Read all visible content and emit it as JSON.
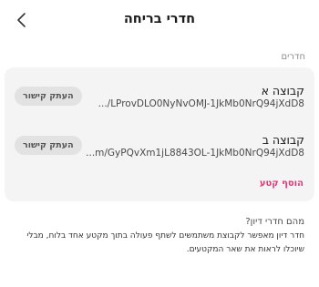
{
  "header": {
    "title": "חדרי בריחה",
    "back_icon": "chevron-left-icon"
  },
  "rooms_section": {
    "label": "חדרים",
    "rooms": [
      {
        "name": "קבוצה א",
        "link": ".../LProvDLO0NyNvOMJ-1JkMb0NrQ94jXdD8",
        "copy_label": "העתק קישור"
      },
      {
        "name": "קבוצה ב",
        "link": "...m/GyPQvXm1jL8843OL-1JkMb0NrQ94jXdD8",
        "copy_label": "העתק קישור"
      }
    ],
    "add_label": "הוסף קטע"
  },
  "info": {
    "title": "מהם חדרי דיון?",
    "text": "חדר דיון מאפשר לקבוצת משתמשים לשתף פעולה בתוך מקטע אחד בלוח, מבלי שיוכלו לראות את שאר המקטעים."
  },
  "colors": {
    "accent": "#e83577",
    "card_bg": "#f4f4f4",
    "button_bg": "#e2e2e2"
  }
}
